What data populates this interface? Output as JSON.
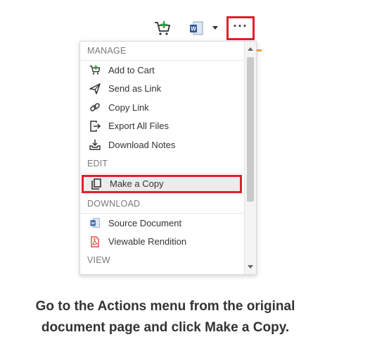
{
  "toolbar": {
    "icons": [
      "add-to-cart-icon",
      "word-document-icon",
      "caret-down-icon",
      "more-actions-icon"
    ],
    "more_label": "···",
    "accent_color": "#e0202d"
  },
  "menu": {
    "sections": [
      {
        "header": "MANAGE",
        "items": [
          {
            "label": "Add to Cart",
            "icon": "add-to-cart-icon"
          },
          {
            "label": "Send as Link",
            "icon": "send-link-icon"
          },
          {
            "label": "Copy Link",
            "icon": "link-icon"
          },
          {
            "label": "Export All Files",
            "icon": "export-icon"
          },
          {
            "label": "Download Notes",
            "icon": "download-notes-icon"
          }
        ]
      },
      {
        "header": "EDIT",
        "items": [
          {
            "label": "Make a Copy",
            "icon": "copy-icon",
            "highlighted": true
          }
        ]
      },
      {
        "header": "DOWNLOAD",
        "items": [
          {
            "label": "Source Document",
            "icon": "word-document-icon"
          },
          {
            "label": "Viewable Rendition",
            "icon": "pdf-icon"
          }
        ]
      },
      {
        "header": "VIEW",
        "items": []
      }
    ]
  },
  "caption": {
    "line1": "Go to the Actions menu from the original",
    "line2": "document page and click Make a Copy."
  }
}
